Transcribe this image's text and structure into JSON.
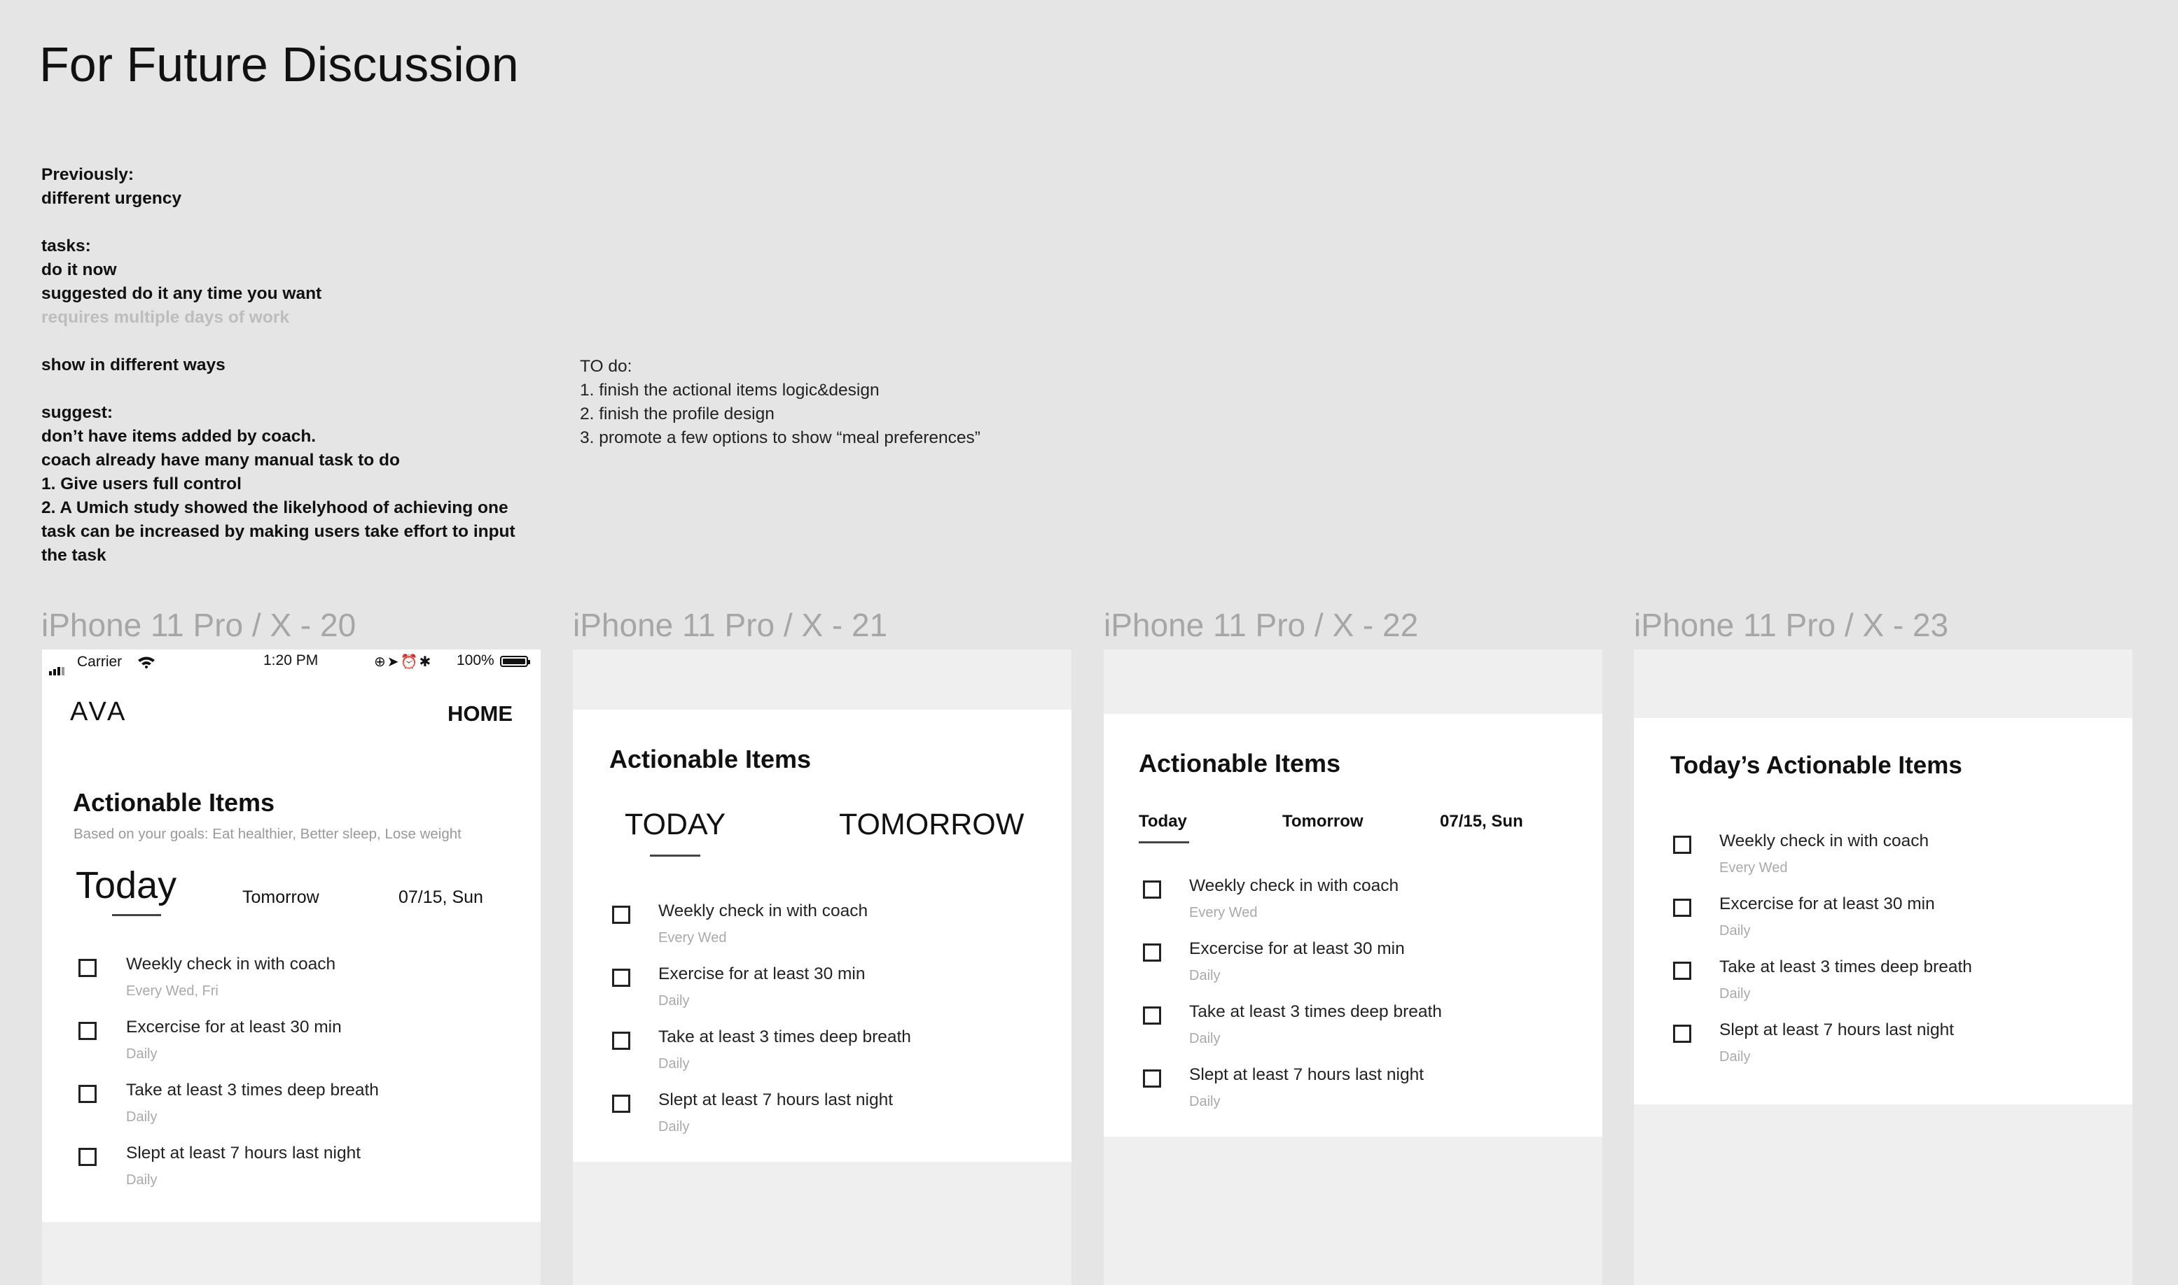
{
  "page_title": "For Future Discussion",
  "notes": [
    {
      "text": "Previously:",
      "style": "bold"
    },
    {
      "text": "different urgency",
      "style": "bold"
    },
    {
      "text": "",
      "style": "blank"
    },
    {
      "text": "tasks:",
      "style": "bold"
    },
    {
      "text": "do it now",
      "style": "bold"
    },
    {
      "text": "suggested do it any time you want",
      "style": "bold"
    },
    {
      "text": "requires multiple days of work",
      "style": "muted"
    },
    {
      "text": "",
      "style": "blank"
    },
    {
      "text": "show in different ways",
      "style": "bold"
    },
    {
      "text": "",
      "style": "blank"
    },
    {
      "text": "suggest:",
      "style": "bold"
    },
    {
      "text": "don’t have items added by coach.",
      "style": "bold"
    },
    {
      "text": "coach already have many manual task to do",
      "style": "bold"
    },
    {
      "text": "1. Give users full control",
      "style": "bold"
    },
    {
      "text": "2. A Umich study showed the likelyhood of achieving one",
      "style": "bold"
    },
    {
      "text": "task can be increased by making users take effort to input",
      "style": "bold"
    },
    {
      "text": "the task",
      "style": "bold"
    }
  ],
  "todo": [
    "TO do:",
    "1. finish the actional items logic&design",
    "2.  finish the profile design",
    "3. promote a few options to show “meal preferences”"
  ],
  "frames": [
    {
      "label": "iPhone 11 Pro / X - 20",
      "status_bar": {
        "carrier": "Carrier",
        "time": "1:20 PM",
        "battery": "100%"
      },
      "logo": "AVA",
      "nav": "HOME",
      "title": "Actionable Items",
      "subtitle": "Based on your goals: Eat healthier, Better sleep, Lose weight",
      "tabs": [
        "Today",
        "Tomorrow",
        "07/15, Sun"
      ],
      "items": [
        {
          "label": "Weekly check in with coach",
          "freq": "Every Wed, Fri"
        },
        {
          "label": "Excercise for at least 30 min",
          "freq": "Daily"
        },
        {
          "label": "Take at least 3 times deep breath",
          "freq": "Daily"
        },
        {
          "label": "Slept at least 7 hours last night",
          "freq": "Daily"
        }
      ]
    },
    {
      "label": "iPhone 11 Pro / X - 21",
      "title": "Actionable Items",
      "tabs": [
        "TODAY",
        "TOMORROW"
      ],
      "items": [
        {
          "label": "Weekly check in with coach",
          "freq": "Every Wed"
        },
        {
          "label": "Exercise for at least 30 min",
          "freq": "Daily"
        },
        {
          "label": "Take at least 3 times deep breath",
          "freq": "Daily"
        },
        {
          "label": "Slept at least 7 hours last night",
          "freq": "Daily"
        }
      ]
    },
    {
      "label": "iPhone 11 Pro / X - 22",
      "title": "Actionable Items",
      "tabs": [
        "Today",
        "Tomorrow",
        "07/15, Sun"
      ],
      "items": [
        {
          "label": "Weekly check in with coach",
          "freq": "Every Wed"
        },
        {
          "label": "Excercise for at least 30 min",
          "freq": "Daily"
        },
        {
          "label": "Take at least 3 times deep breath",
          "freq": "Daily"
        },
        {
          "label": "Slept at least 7 hours last night",
          "freq": "Daily"
        }
      ]
    },
    {
      "label": "iPhone 11 Pro / X - 23",
      "title": "Today’s Actionable Items",
      "items": [
        {
          "label": "Weekly check in with coach",
          "freq": "Every Wed"
        },
        {
          "label": "Excercise for at least 30 min",
          "freq": "Daily"
        },
        {
          "label": "Take at least 3 times deep breath",
          "freq": "Daily"
        },
        {
          "label": "Slept at least 7 hours last night",
          "freq": "Daily"
        }
      ]
    }
  ]
}
